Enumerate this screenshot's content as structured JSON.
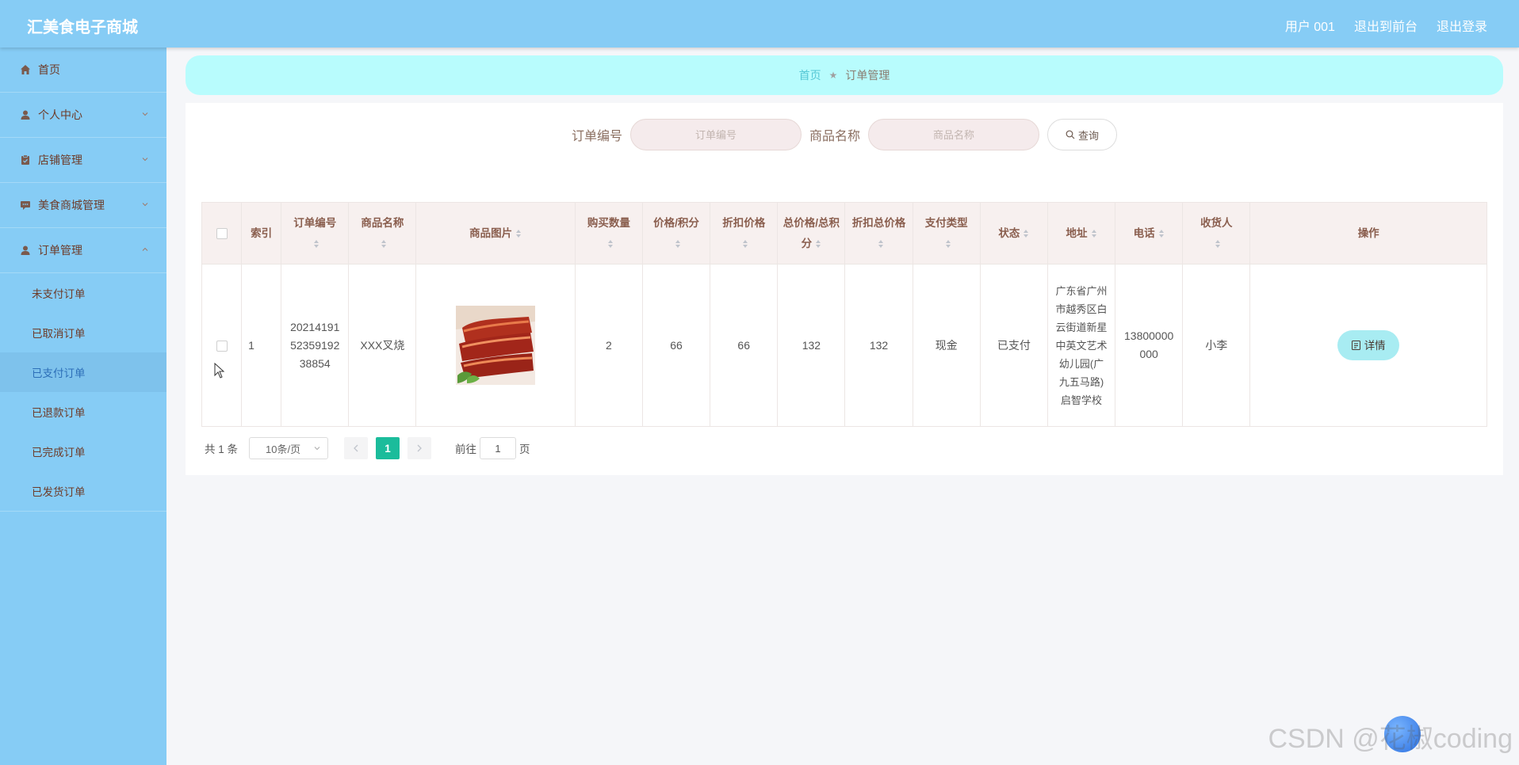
{
  "header": {
    "brand": "汇美食电子商城",
    "links": [
      "用户 001",
      "退出到前台",
      "退出登录"
    ]
  },
  "sidebar": {
    "items": [
      {
        "label": "首页",
        "icon": "home-icon"
      },
      {
        "label": "个人中心",
        "icon": "user-icon"
      },
      {
        "label": "店铺管理",
        "icon": "clipboard-icon"
      },
      {
        "label": "美食商城管理",
        "icon": "chat-icon"
      },
      {
        "label": "订单管理",
        "icon": "user-icon"
      }
    ],
    "order_sub_items": [
      "未支付订单",
      "已取消订单",
      "已支付订单",
      "已退款订单",
      "已完成订单",
      "已发货订单"
    ],
    "active_sub_item": "已支付订单"
  },
  "breadcrumb": {
    "home": "首页",
    "current": "订单管理"
  },
  "search": {
    "order_no_label": "订单编号",
    "order_no_placeholder": "订单编号",
    "product_name_label": "商品名称",
    "product_name_placeholder": "商品名称",
    "query_button": "查询"
  },
  "table": {
    "headers": [
      "索引",
      "订单编号",
      "商品名称",
      "商品图片",
      "购买数量",
      "价格/积分",
      "折扣价格",
      "总价格/总积分",
      "折扣总价格",
      "支付类型",
      "状态",
      "地址",
      "电话",
      "收货人",
      "操作"
    ],
    "rows": [
      {
        "index": "1",
        "order_no": "202141915235919238854",
        "product_name": "XXX叉烧",
        "quantity": "2",
        "price": "66",
        "discount_price": "66",
        "total_price": "132",
        "discount_total": "132",
        "pay_type": "现金",
        "status": "已支付",
        "address": "广东省广州市越秀区白云街道新星中英文艺术幼儿园(广九五马路)启智学校",
        "phone": "13800000000",
        "receiver": "小李",
        "action": "详情"
      }
    ]
  },
  "pagination": {
    "total": "共 1 条",
    "page_size": "10条/页",
    "current_page": "1",
    "goto_prefix": "前往",
    "goto_value": "1",
    "goto_suffix": "页"
  },
  "watermark": "CSDN @花椒coding"
}
